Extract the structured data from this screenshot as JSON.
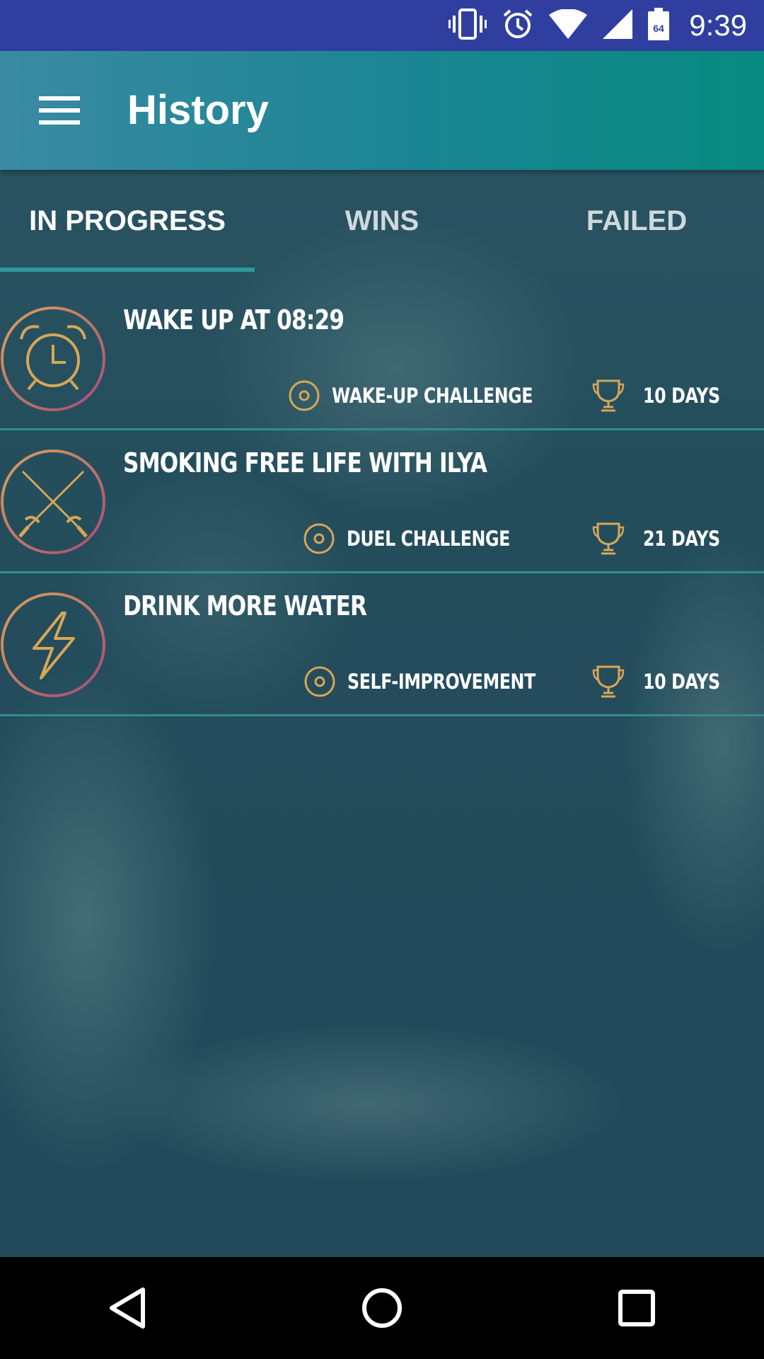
{
  "status_bar": {
    "time": "9:39",
    "battery_level": "64",
    "icons": [
      "vibrate-icon",
      "alarm-icon",
      "wifi-icon",
      "cell-signal-icon",
      "battery-icon"
    ]
  },
  "app_bar": {
    "title": "History",
    "menu_icon": "hamburger-menu-icon"
  },
  "tabs": [
    {
      "label": "IN PROGRESS",
      "active": true
    },
    {
      "label": "WINS",
      "active": false
    },
    {
      "label": "FAILED",
      "active": false
    }
  ],
  "challenges": [
    {
      "title": "WAKE UP AT 08:29",
      "icon": "alarm-clock-icon",
      "category": "WAKE-UP CHALLENGE",
      "duration": "10 DAYS"
    },
    {
      "title": "SMOKING FREE LIFE WITH ILYA",
      "icon": "crossed-swords-icon",
      "category": "DUEL CHALLENGE",
      "duration": "21 DAYS"
    },
    {
      "title": "DRINK MORE WATER",
      "icon": "lightning-bolt-icon",
      "category": "SELF-IMPROVEMENT",
      "duration": "10 DAYS"
    }
  ],
  "colors": {
    "status_bar": "#303f9f",
    "accent_gold": "#d8a657",
    "tab_indicator": "#2b9a98",
    "divider": "#2f8e8c"
  },
  "nav_bar": {
    "icons": [
      "back-icon",
      "home-icon",
      "recents-icon"
    ]
  }
}
